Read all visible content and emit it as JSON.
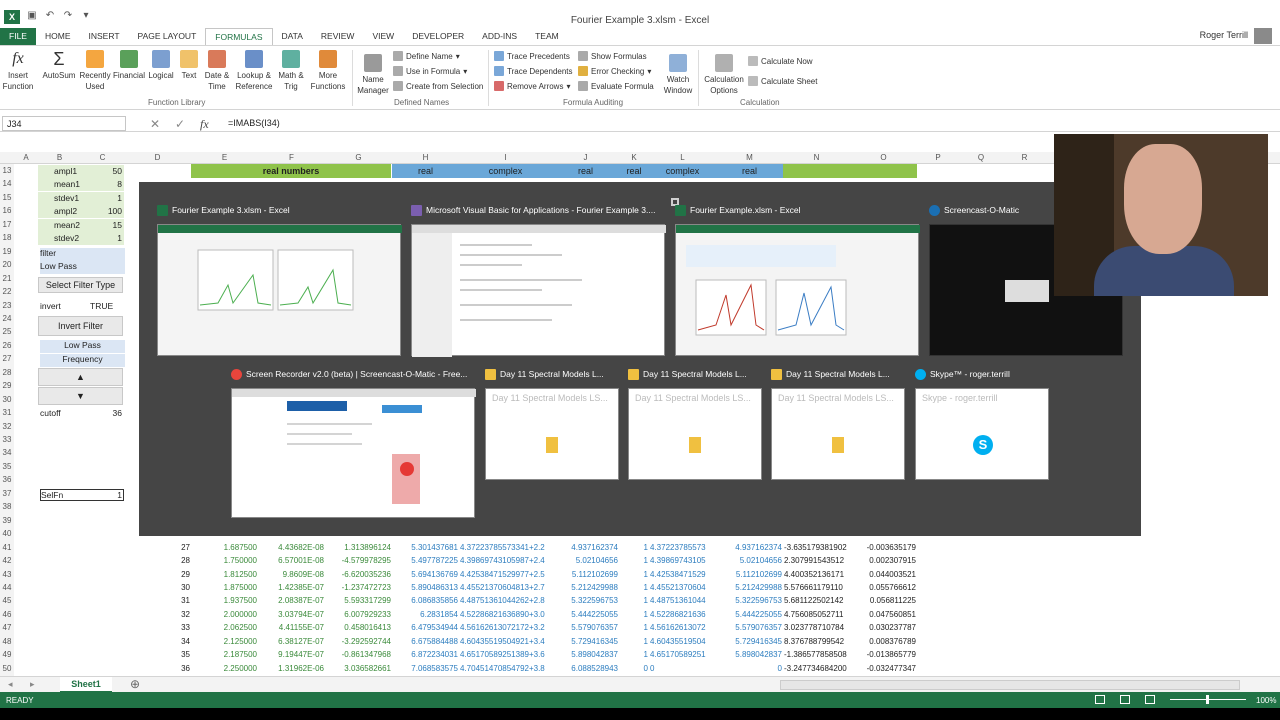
{
  "window": {
    "title": "Fourier Example 3.xlsm - Excel"
  },
  "ribbon_tabs": [
    "FILE",
    "HOME",
    "INSERT",
    "PAGE LAYOUT",
    "FORMULAS",
    "DATA",
    "REVIEW",
    "VIEW",
    "DEVELOPER",
    "ADD-INS",
    "TEAM"
  ],
  "user": "Roger Terrill",
  "ribbon": {
    "insert_function": "Insert Function",
    "autosum": "AutoSum",
    "recently_used": "Recently Used",
    "financial": "Financial",
    "logical": "Logical",
    "text": "Text",
    "date_time": "Date & Time",
    "lookup": "Lookup & Reference",
    "math": "Math & Trig",
    "more": "More Functions",
    "group_library": "Function Library",
    "name_manager": "Name Manager",
    "define_name": "Define Name",
    "use_in_formula": "Use in Formula",
    "create_from_selection": "Create from Selection",
    "group_names": "Defined Names",
    "trace_precedents": "Trace Precedents",
    "trace_dependents": "Trace Dependents",
    "remove_arrows": "Remove Arrows",
    "show_formulas": "Show Formulas",
    "error_checking": "Error Checking",
    "evaluate_formula": "Evaluate Formula",
    "group_auditing": "Formula Auditing",
    "watch_window": "Watch Window",
    "calc_options": "Calculation Options",
    "calc_now": "Calculate Now",
    "calc_sheet": "Calculate Sheet",
    "group_calc": "Calculation"
  },
  "namebox": "J34",
  "formula": "=IMABS(I34)",
  "columns": [
    "A",
    "B",
    "C",
    "D",
    "E",
    "F",
    "G",
    "H",
    "I",
    "J",
    "K",
    "L",
    "M",
    "N",
    "O",
    "P",
    "Q",
    "R"
  ],
  "row_numbers": [
    "13",
    "14",
    "15",
    "16",
    "17",
    "18",
    "19",
    "20",
    "21",
    "22",
    "23",
    "24",
    "25",
    "26",
    "27",
    "28",
    "29",
    "30",
    "31",
    "32",
    "33",
    "34",
    "35",
    "36",
    "37",
    "38",
    "39",
    "40",
    "41",
    "42",
    "43",
    "44",
    "45",
    "46",
    "47",
    "48",
    "49",
    "50"
  ],
  "header_bands": {
    "real_numbers": "real numbers",
    "real1": "real",
    "complex1": "complex",
    "real2": "real",
    "real3": "real",
    "complex2": "complex",
    "real4": "real"
  },
  "params": [
    {
      "label": "ampl1",
      "value": "50"
    },
    {
      "label": "mean1",
      "value": "8"
    },
    {
      "label": "stdev1",
      "value": "1"
    },
    {
      "label": "ampl2",
      "value": "100"
    },
    {
      "label": "mean2",
      "value": "15"
    },
    {
      "label": "stdev2",
      "value": "1"
    }
  ],
  "panel": {
    "filter": "filter",
    "low_pass": "Low Pass",
    "select_filter_type": "Select Filter Type",
    "invert_label": "invert",
    "invert_value": "TRUE",
    "invert_filter": "Invert Filter",
    "low_pass2": "Low Pass",
    "frequency": "Frequency",
    "up": "▲",
    "down": "▼",
    "cutoff_label": "cutoff",
    "cutoff_value": "36",
    "selfn_label": "SelFn",
    "selfn_value": "1"
  },
  "data_rows": [
    {
      "d": "27",
      "e": "1.687500",
      "f": "4.43682E-08",
      "g": "1.313896124",
      "h": "5.301437681",
      "i": "4.37223785573341+2.2",
      "j": "4.937162374",
      "k": "1",
      "l": "4.37223785573",
      "m": "4.937162374",
      "n": "-3.635179381902",
      "o": "-0.003635179"
    },
    {
      "d": "28",
      "e": "1.750000",
      "f": "6.57001E-08",
      "g": "-4.579978295",
      "h": "5.497787225",
      "i": "4.39869743105987+2.4",
      "j": "5.02104656",
      "k": "1",
      "l": "4.39869743105",
      "m": "5.02104656",
      "n": "2.307991543512",
      "o": "0.002307915"
    },
    {
      "d": "29",
      "e": "1.812500",
      "f": "9.8609E-08",
      "g": "-6.620035236",
      "h": "5.694136769",
      "i": "4.42538471529977+2.5",
      "j": "5.112102699",
      "k": "1",
      "l": "4.42538471529",
      "m": "5.112102699",
      "n": "4.400352136171",
      "o": "0.044003521"
    },
    {
      "d": "30",
      "e": "1.875000",
      "f": "1.42385E-07",
      "g": "-1.237472723",
      "h": "5.890486313",
      "i": "4.45521370604813+2.7",
      "j": "5.212429988",
      "k": "1",
      "l": "4.45521370604",
      "m": "5.212429988",
      "n": "5.576661179110",
      "o": "0.055766612"
    },
    {
      "d": "31",
      "e": "1.937500",
      "f": "2.08387E-07",
      "g": "5.593317299",
      "h": "6.086835856",
      "i": "4.48751361044262+2.8",
      "j": "5.322596753",
      "k": "1",
      "l": "4.48751361044",
      "m": "5.322596753",
      "n": "5.681122502142",
      "o": "0.056811225"
    },
    {
      "d": "32",
      "e": "2.000000",
      "f": "3.03794E-07",
      "g": "6.007929233",
      "h": "6.2831854",
      "i": "4.52286821636890+3.0",
      "j": "5.444225055",
      "k": "1",
      "l": "4.52286821636",
      "m": "5.444225055",
      "n": "4.756085052711",
      "o": "0.047560851"
    },
    {
      "d": "33",
      "e": "2.062500",
      "f": "4.41155E-07",
      "g": "0.458016413",
      "h": "6.479534944",
      "i": "4.56162613072172+3.2",
      "j": "5.579076357",
      "k": "1",
      "l": "4.56162613072",
      "m": "5.579076357",
      "n": "3.023778710784",
      "o": "0.030237787"
    },
    {
      "d": "34",
      "e": "2.125000",
      "f": "6.38127E-07",
      "g": "-3.292592744",
      "h": "6.675884488",
      "i": "4.60435519504921+3.4",
      "j": "5.729416345",
      "k": "1",
      "l": "4.60435519504",
      "m": "5.729416345",
      "n": "8.376788799542",
      "o": "0.008376789"
    },
    {
      "d": "35",
      "e": "2.187500",
      "f": "9.19447E-07",
      "g": "-0.861347968",
      "h": "6.872234031",
      "i": "4.65170589251389+3.6",
      "j": "5.898042837",
      "k": "1",
      "l": "4.65170589251",
      "m": "5.898042837",
      "n": "-1.386577858508",
      "o": "-0.013865779"
    },
    {
      "d": "36",
      "e": "2.250000",
      "f": "1.31962E-06",
      "g": "3.036582661",
      "h": "7.068583575",
      "i": "4.70451470854792+3.8",
      "j": "6.088528943",
      "k": "0",
      "l": "0",
      "m": "0",
      "n": "-3.247734684200",
      "o": "-0.032477347"
    }
  ],
  "switcher": [
    {
      "title": "Fourier Example 3.xlsm - Excel",
      "icon": "excel-icon"
    },
    {
      "title": "Microsoft Visual Basic for Applications - Fourier Example 3....",
      "icon": "vba-icon"
    },
    {
      "title": "Fourier Example.xlsm - Excel",
      "icon": "excel-icon"
    },
    {
      "title": "Screencast-O-Matic",
      "icon": "screencast-icon"
    },
    {
      "title": "Screen Recorder v2.0 (beta) | Screencast-O-Matic - Free...",
      "icon": "chrome-icon"
    },
    {
      "title": "Day 11 Spectral Models L...",
      "icon": "folder-icon",
      "sub": "Day 11 Spectral Models LS..."
    },
    {
      "title": "Day 11 Spectral Models L...",
      "icon": "folder-icon",
      "sub": "Day 11 Spectral Models LS..."
    },
    {
      "title": "Day 11 Spectral Models L...",
      "icon": "folder-icon",
      "sub": "Day 11 Spectral Models LS..."
    },
    {
      "title": "Skype™ - roger.terrill",
      "icon": "skype-icon",
      "sub": "Skype - roger.terrill"
    }
  ],
  "sheet_tab": "Sheet1",
  "status": {
    "ready": "READY",
    "zoom": "100%"
  },
  "colors": {
    "excel_green": "#217346",
    "band_green": "#8fc34a",
    "band_blue": "#6aa7d8",
    "panel_blue": "#dbe6f4"
  }
}
